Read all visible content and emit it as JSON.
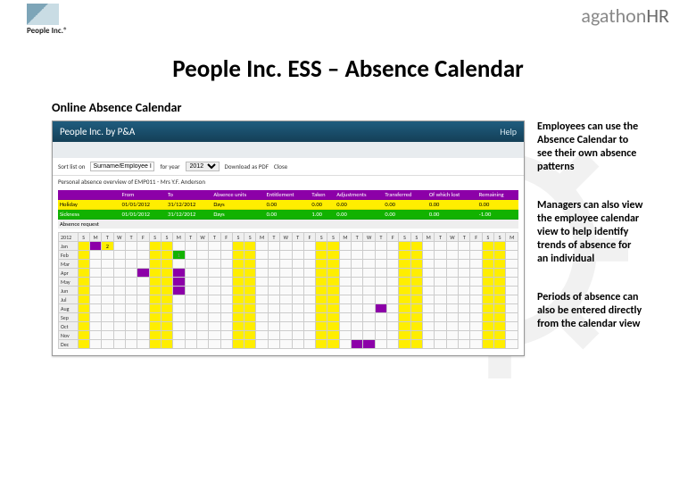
{
  "header": {
    "left_logo_caption": "People Inc.®",
    "right_logo_text_a": "agathon",
    "right_logo_text_b": "HR"
  },
  "title": "People Inc. ESS – Absence Calendar",
  "section_label": "Online Absence Calendar",
  "desc": {
    "p1": "Employees can use the Absence Calendar to see their own absence patterns",
    "p2": "Managers can also view the employee calendar view to help identify trends of absence for an individual",
    "p3": "Periods of absence can also be entered directly from the calendar view"
  },
  "shot": {
    "app_title": "People Inc. by P&A",
    "help_label": "Help",
    "controls": {
      "sort_label": "Sort list on",
      "sort_value": "Surname/Employee ID",
      "for_year_label": "for year",
      "year_value": "2012",
      "download_label": "Download as PDF",
      "close_label": "Close"
    },
    "subtitle": "Personal absence overview of EMP011 - Mrs Y.F. Anderson",
    "summary": {
      "headers": [
        "",
        "From",
        "To",
        "Absence units",
        "Entitlement",
        "Taken",
        "Adjustments",
        "Transferred",
        "Of which lost",
        "Remaining"
      ],
      "rows": [
        {
          "class": "holiday",
          "cells": [
            "Holiday",
            "01/01/2012",
            "31/12/2012",
            "Days",
            "0.00",
            "0.00",
            "0.00",
            "0.00",
            "0.00",
            "0.00"
          ]
        },
        {
          "class": "sick",
          "cells": [
            "Sickness",
            "01/01/2012",
            "31/12/2012",
            "Days",
            "0.00",
            "1.00",
            "0.00",
            "0.00",
            "0.00",
            "-1.00"
          ]
        },
        {
          "class": "req",
          "cells": [
            "Absence request",
            "",
            "",
            "",
            "",
            "",
            "",
            "",
            "",
            ""
          ]
        }
      ]
    },
    "calendar": {
      "year": "2012",
      "day_headers": [
        "S",
        "M",
        "T",
        "W",
        "T",
        "F",
        "S",
        "S",
        "M",
        "T",
        "W",
        "T",
        "F",
        "S",
        "S",
        "M",
        "T",
        "W",
        "T",
        "F",
        "S",
        "S",
        "M",
        "T",
        "W",
        "T",
        "F",
        "S",
        "S",
        "M",
        "T",
        "W",
        "T",
        "F",
        "S",
        "S",
        "M"
      ],
      "months": [
        "Jan",
        "Feb",
        "Mar",
        "Apr",
        "May",
        "Jun",
        "Jul",
        "Aug",
        "Sep",
        "Oct",
        "Nov",
        "Dec"
      ]
    }
  }
}
